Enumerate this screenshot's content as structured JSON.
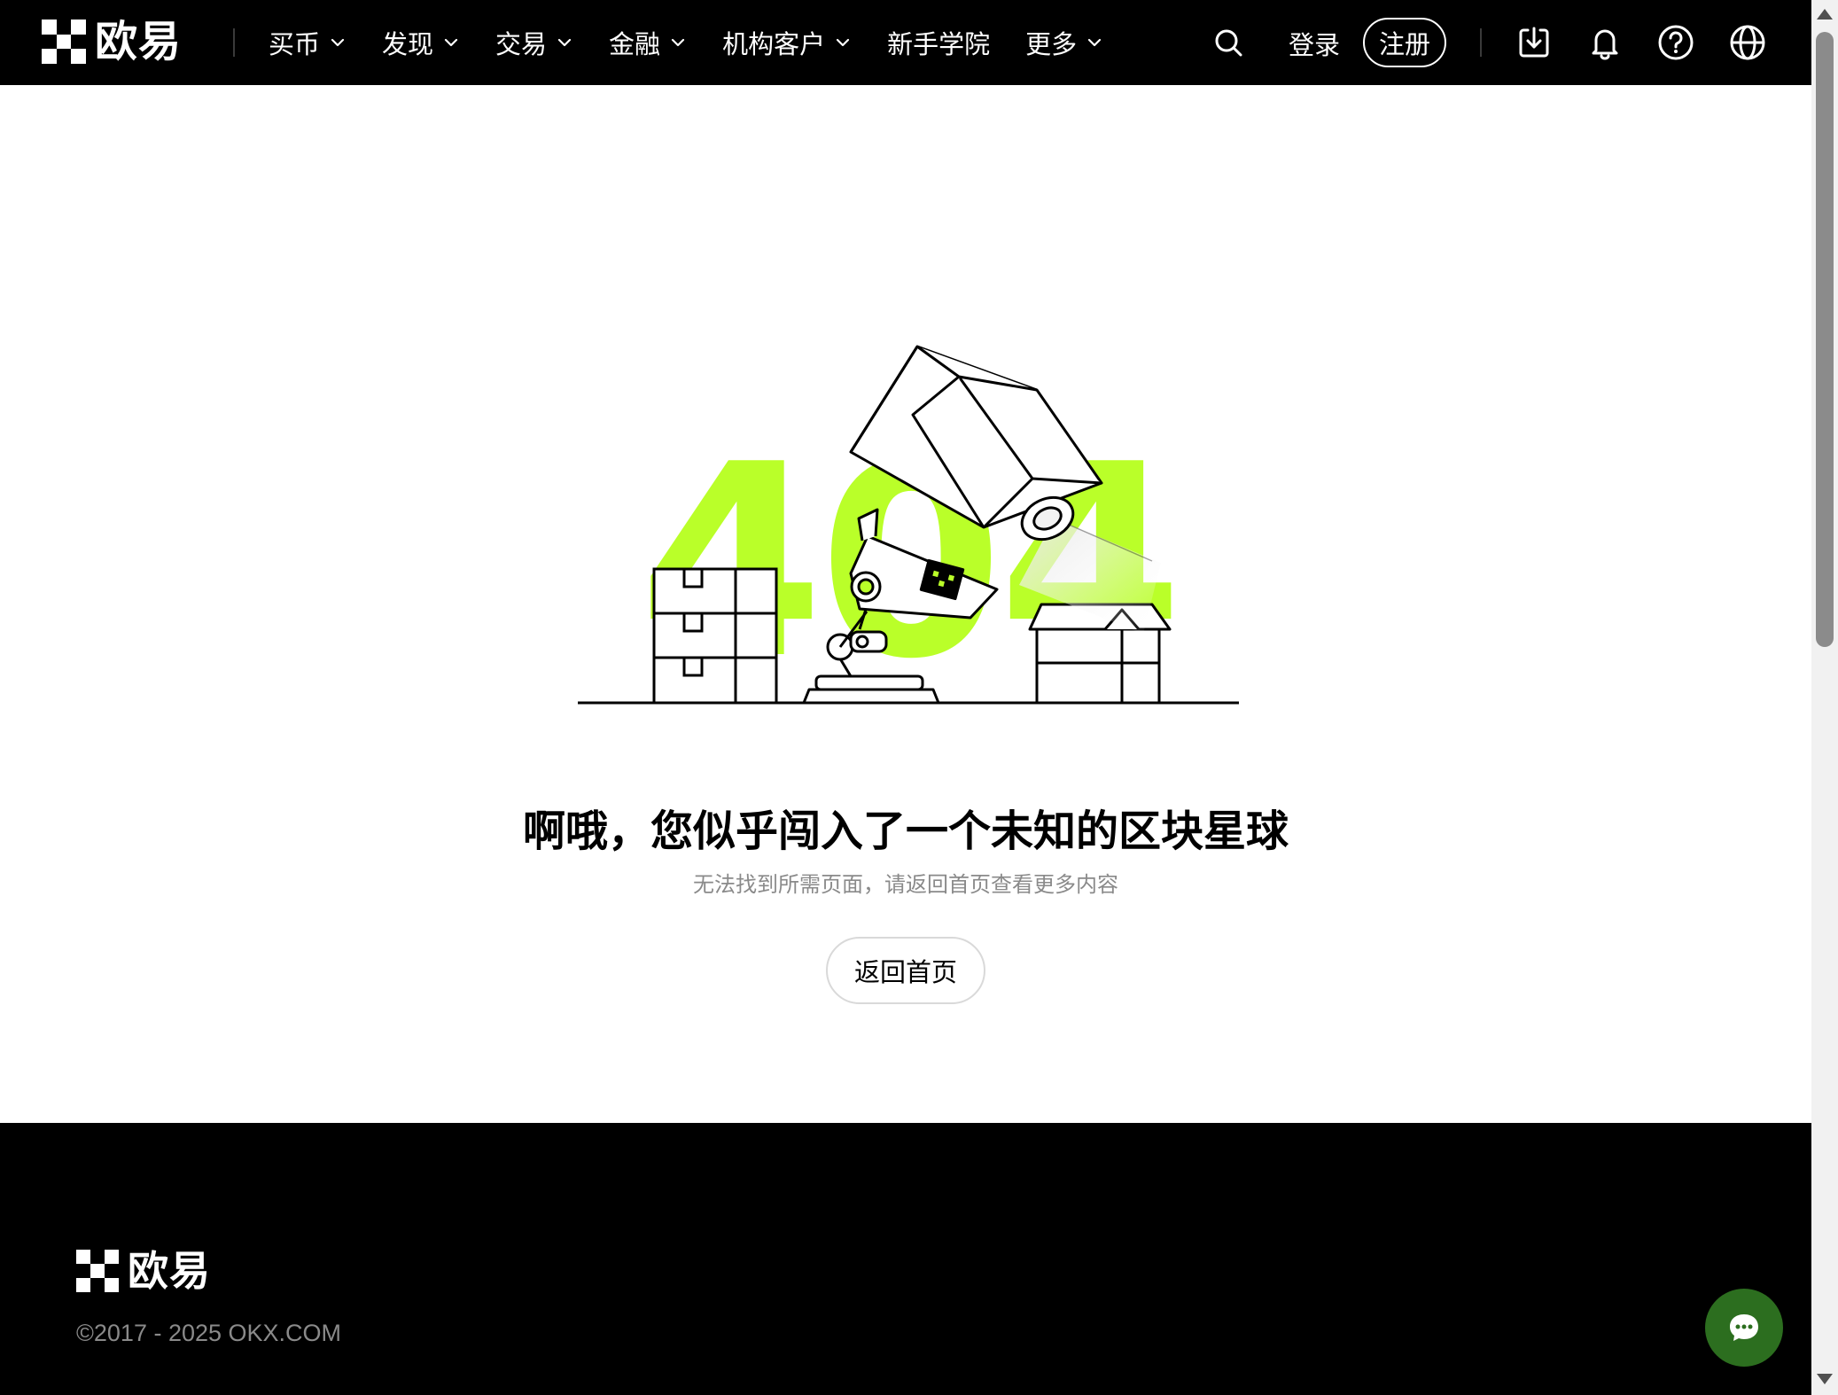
{
  "brand": {
    "name": "欧易"
  },
  "nav": {
    "items": [
      {
        "label": "买币",
        "has_dropdown": true
      },
      {
        "label": "发现",
        "has_dropdown": true
      },
      {
        "label": "交易",
        "has_dropdown": true
      },
      {
        "label": "金融",
        "has_dropdown": true
      },
      {
        "label": "机构客户",
        "has_dropdown": true
      },
      {
        "label": "新手学院",
        "has_dropdown": false
      },
      {
        "label": "更多",
        "has_dropdown": true
      }
    ]
  },
  "header": {
    "login_label": "登录",
    "register_label": "注册",
    "icons": [
      "search-icon",
      "download-icon",
      "bell-icon",
      "help-icon",
      "globe-icon"
    ]
  },
  "error": {
    "code": "404",
    "title": "啊哦，您似乎闯入了一个未知的区块星球",
    "subtitle": "无法找到所需页面，请返回首页查看更多内容",
    "home_button": "返回首页"
  },
  "footer": {
    "brand": "欧易",
    "copyright": "©2017 - 2025 OKX.COM"
  },
  "colors": {
    "header_bg": "#000000",
    "accent_green": "#BAFF29",
    "chat_button": "#2C6E1F",
    "subtitle_gray": "#8A8A8A"
  }
}
